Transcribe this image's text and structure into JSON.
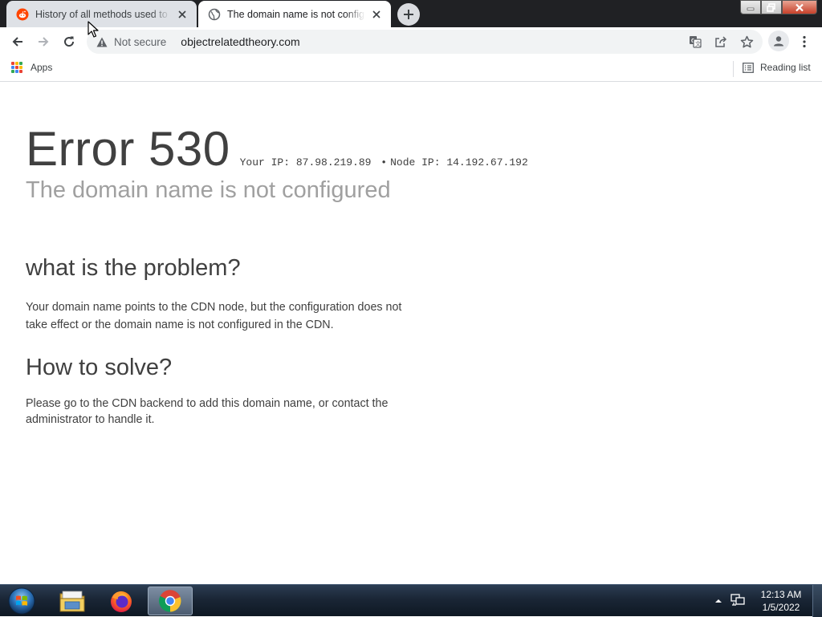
{
  "browser": {
    "tabs": [
      {
        "title": "History of all methods used to ar",
        "favicon": "reddit-icon",
        "active": false
      },
      {
        "title": "The domain name is not configured",
        "favicon": "globe-icon",
        "active": true
      }
    ],
    "address": {
      "security_label": "Not secure",
      "url": "objectrelatedtheory.com"
    },
    "bookmarks": {
      "apps_label": "Apps",
      "reading_list_label": "Reading list"
    }
  },
  "page": {
    "error_code": "Error 530",
    "your_ip_label": "Your IP:",
    "your_ip": "87.98.219.89",
    "separator": "•",
    "node_ip_label": "Node IP:",
    "node_ip": "14.192.67.192",
    "subtitle": "The domain name is not configured",
    "problem_heading": "what is the problem?",
    "problem_text": "Your domain name points to the CDN node, but the configuration does not take effect or the domain name is not configured in the CDN.",
    "solve_heading": "How to solve?",
    "solve_text": "Please go to the CDN backend to add this domain name, or contact the administrator to handle it."
  },
  "taskbar": {
    "apps": [
      "file-explorer-icon",
      "firefox-icon",
      "chrome-icon"
    ],
    "active_app": "chrome-icon",
    "time": "12:13 AM",
    "date": "1/5/2022"
  },
  "colors": {
    "tabstrip": "#202124",
    "accent_reddit": "#ff4500",
    "text": "#404040",
    "subtitle": "#a0a0a0"
  }
}
